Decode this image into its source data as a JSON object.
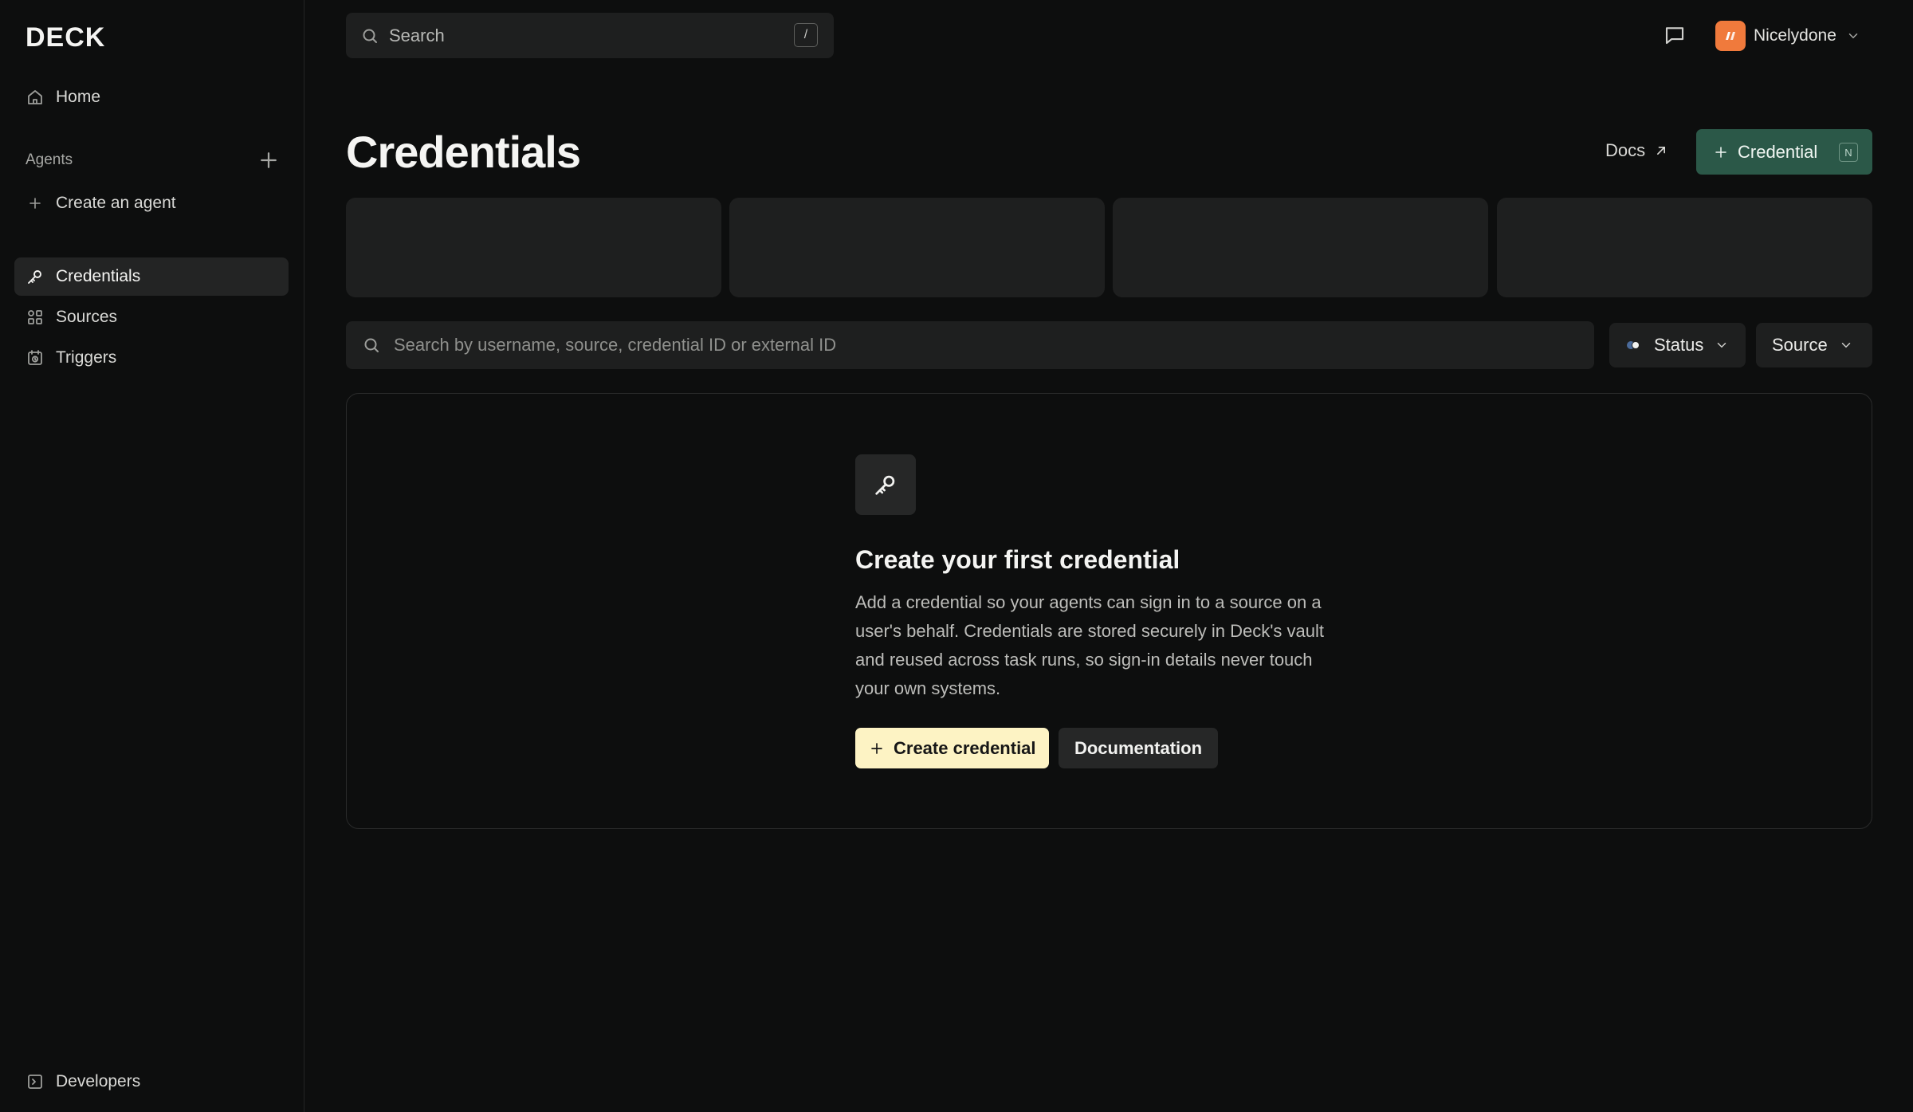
{
  "app": {
    "logo": "DECK"
  },
  "sidebar": {
    "home": {
      "label": "Home",
      "icon": "home-icon"
    },
    "agents_section": {
      "label": "Agents"
    },
    "create_agent": {
      "label": "Create an agent"
    },
    "items": [
      {
        "label": "Credentials",
        "icon": "key-icon",
        "active": true
      },
      {
        "label": "Sources",
        "icon": "grid-icon",
        "active": false
      },
      {
        "label": "Triggers",
        "icon": "calendar-clock-icon",
        "active": false
      }
    ],
    "developers": {
      "label": "Developers",
      "icon": "terminal-icon"
    }
  },
  "topbar": {
    "search": {
      "label": "Search",
      "shortcut": "/"
    },
    "org": {
      "name": "Nicelydone",
      "color": "#f07a3c"
    }
  },
  "header": {
    "title": "Credentials",
    "docs_label": "Docs",
    "primary_button": {
      "label": "Credential",
      "shortcut": "N",
      "color": "#2b5848"
    }
  },
  "filters": {
    "search_placeholder": "Search by username, source, credential ID or external ID",
    "status_label": "Status",
    "source_label": "Source"
  },
  "empty_state": {
    "title": "Create your first credential",
    "description": "Add a credential so your agents can sign in to a source on a user's behalf. Credentials are stored securely in Deck's vault and reused across task runs, so sign-in details never touch your own systems.",
    "primary_button": "Create credential",
    "secondary_button": "Documentation",
    "primary_color": "#fdf3c4"
  }
}
